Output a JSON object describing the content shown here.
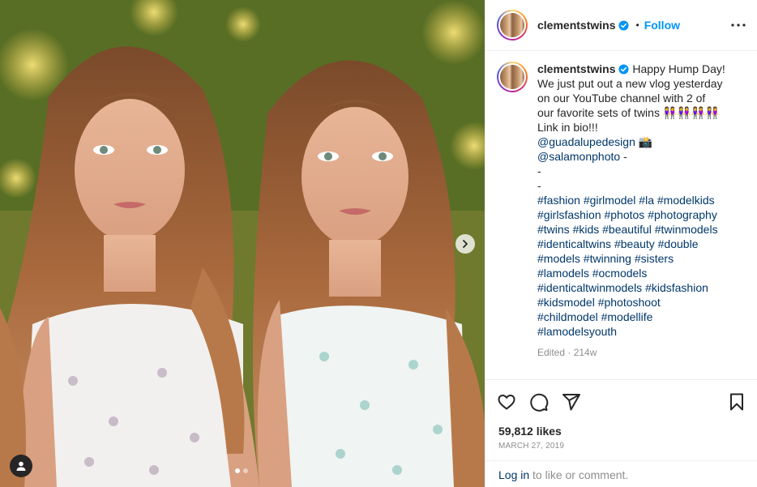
{
  "post": {
    "username": "clementstwins",
    "follow_label": "Follow",
    "bullet": "•",
    "caption_lines": [
      "Happy Hump Day!",
      "We just put out a new vlog yesterday",
      "on our YouTube channel with 2 of",
      "our favorite sets of twins 👭👭👭👭",
      "Link in bio!!!"
    ],
    "mentions": [
      {
        "handle": "@guadalupedesign",
        "suffix": " 📸"
      },
      {
        "handle": "@salamonphoto",
        "suffix": " -"
      }
    ],
    "dash_lines": [
      "-",
      "-"
    ],
    "hashtag_lines": [
      "#fashion #girlmodel #la #modelkids",
      "#girlsfashion #photos #photography",
      "#twins #kids #beautiful #twinmodels",
      "#identicaltwins #beauty #double",
      "#models #twinning #sisters",
      "#lamodels #ocmodels",
      "#identicaltwinmodels #kidsfashion",
      "#kidsmodel #photoshoot",
      "#childmodel #modellife",
      "#lamodelsyouth"
    ],
    "edited_label": "Edited · 214w",
    "likes_text": "59,812 likes",
    "date_text": "MARCH 27, 2019",
    "comment_prefix": "Log in",
    "comment_suffix": " to like or comment."
  },
  "carousel": {
    "slide_count": 2,
    "active_index": 0
  },
  "icons": {
    "verified": "verified-badge-icon",
    "more": "more-options-icon",
    "like": "heart-icon",
    "comment": "comment-icon",
    "share": "share-icon",
    "save": "bookmark-icon",
    "next": "chevron-right-icon",
    "tag": "user-tag-icon"
  },
  "colors": {
    "accent": "#0095f6",
    "link": "#00376b",
    "muted": "#8e8e8e",
    "text": "#262626",
    "border": "#efefef"
  }
}
